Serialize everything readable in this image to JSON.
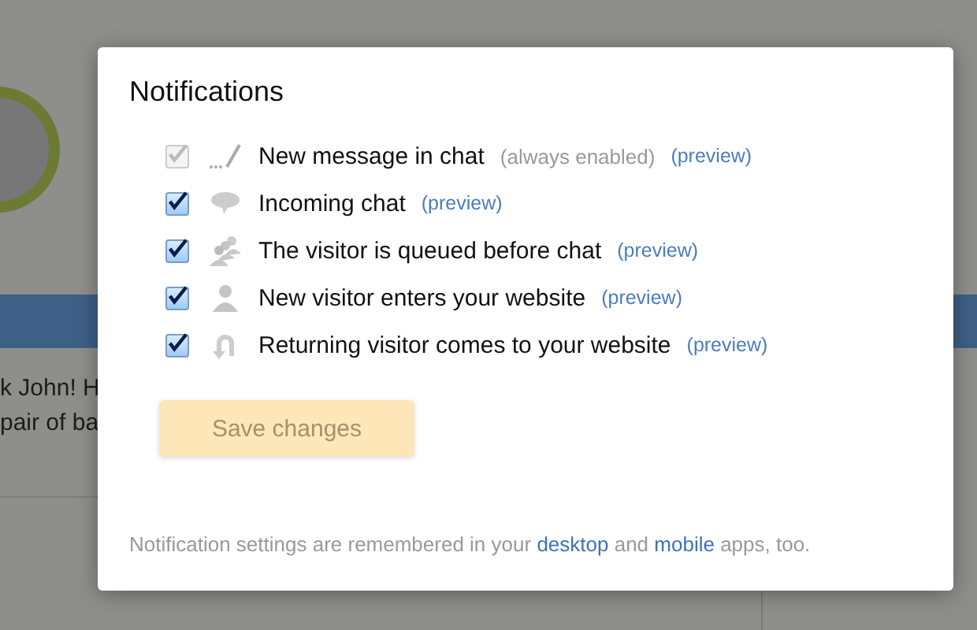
{
  "background": {
    "lines": [
      "k John! H",
      "pair of ba"
    ]
  },
  "dialog": {
    "title": "Notifications",
    "items": [
      {
        "kind": "typing",
        "label": "New message in chat",
        "note": "(always enabled)",
        "preview": "(preview)",
        "checked": true,
        "disabled": true
      },
      {
        "kind": "bubble",
        "label": "Incoming chat",
        "preview": "(preview)",
        "checked": true,
        "disabled": false
      },
      {
        "kind": "queue",
        "label": "The visitor is queued before chat",
        "preview": "(preview)",
        "checked": true,
        "disabled": false
      },
      {
        "kind": "person",
        "label": "New visitor enters your website",
        "preview": "(preview)",
        "checked": true,
        "disabled": false
      },
      {
        "kind": "return",
        "label": "Returning visitor comes to your website",
        "preview": "(preview)",
        "checked": true,
        "disabled": false
      }
    ],
    "save_button": {
      "label": "Save changes",
      "disabled": true
    },
    "footer": [
      {
        "kind": "text",
        "text": "Notification settings are remembered in your "
      },
      {
        "kind": "link",
        "text": "desktop"
      },
      {
        "kind": "text",
        "text": " and "
      },
      {
        "kind": "link",
        "text": "mobile"
      },
      {
        "kind": "text",
        "text": " apps, too."
      }
    ]
  }
}
